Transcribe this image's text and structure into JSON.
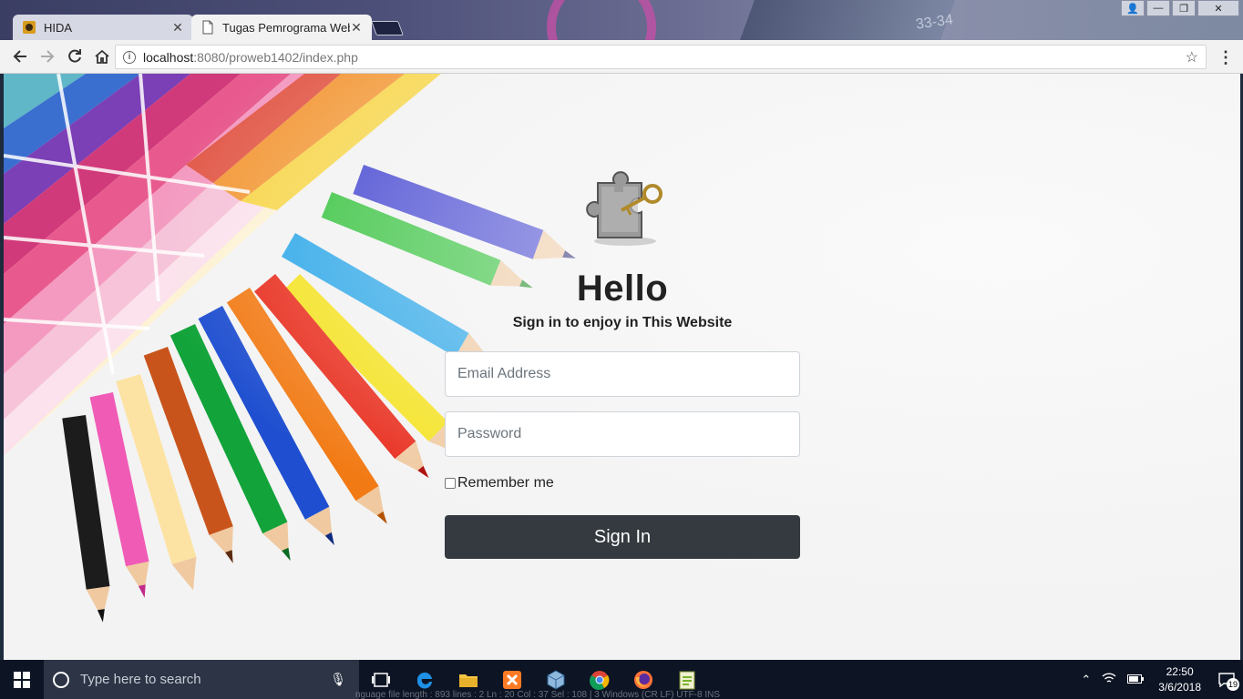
{
  "browser": {
    "tabs": [
      {
        "title": "HIDA",
        "active": false
      },
      {
        "title": "Tugas Pemrograma Web",
        "active": true
      }
    ],
    "close_glyph": "✕",
    "window_buttons": {
      "user": "👤",
      "minimize": "—",
      "restore": "❐",
      "close": "✕"
    },
    "address": {
      "host": "localhost",
      "path": ":8080/proweb1402/index.php"
    },
    "title_decor": "33-34"
  },
  "page": {
    "heading": "Hello",
    "subtitle": "Sign in to enjoy in This Website",
    "email_placeholder": "Email Address",
    "password_placeholder": "Password",
    "remember_label": "Remember me",
    "signin_label": "Sign In"
  },
  "taskbar": {
    "search_placeholder": "Type here to search",
    "time": "22:50",
    "date": "3/6/2018",
    "notification_count": "19",
    "background_text": "nguage file          length : 893     lines : 2          Ln : 20    Col : 37    Sel : 108 | 3               Windows (CR LF)     UTF-8            INS"
  },
  "colors": {
    "signin_bg": "#343a40",
    "taskbar_bg": "#0d1424"
  }
}
